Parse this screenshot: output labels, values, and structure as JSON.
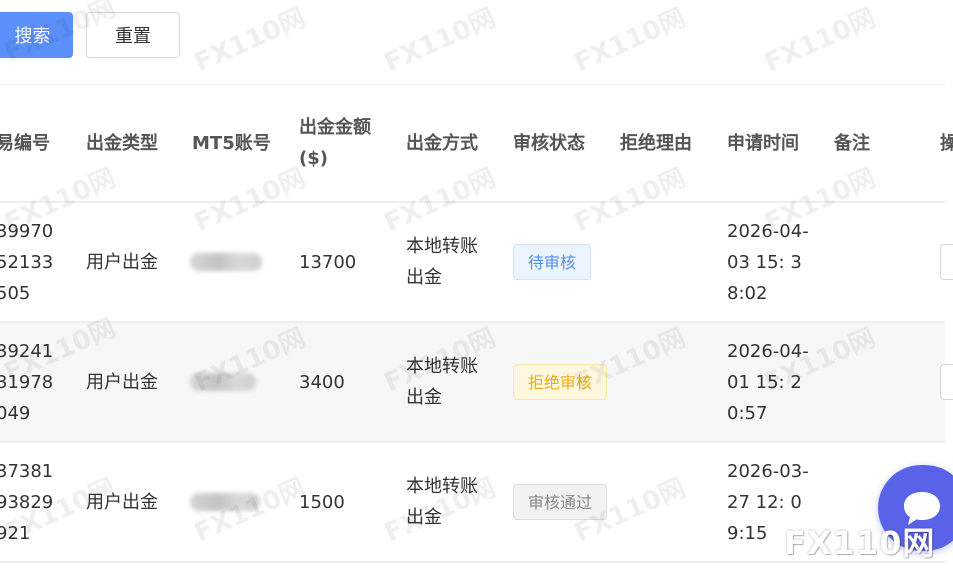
{
  "toolbar": {
    "search_label": "搜索",
    "reset_label": "重置"
  },
  "table": {
    "columns": [
      "易编号",
      "出金类型",
      "MT5账号",
      "出金金额",
      "($)",
      "出金方式",
      "审核状态",
      "拒绝理由",
      "申请时间",
      "备注",
      "操"
    ],
    "rows": [
      {
        "id_lines": [
          "39970",
          "52133",
          "505"
        ],
        "type": "用户出金",
        "amount": "13700",
        "method_lines": [
          "本地转账",
          "出金"
        ],
        "status": "待审核",
        "reason": "",
        "time_lines": [
          "2026-04-",
          "03 15: 3",
          "8:02"
        ],
        "note": ""
      },
      {
        "id_lines": [
          "39241",
          "31978",
          "049"
        ],
        "type": "用户出金",
        "amount": "3400",
        "method_lines": [
          "本地转账",
          "出金"
        ],
        "status": "拒绝审核",
        "reason": "",
        "time_lines": [
          "2026-04-",
          "01 15: 2",
          "0:57"
        ],
        "note": ""
      },
      {
        "id_lines": [
          "37381",
          "93829",
          "921"
        ],
        "type": "用户出金",
        "amount": "1500",
        "method_lines": [
          "本地转账",
          "出金"
        ],
        "status": "审核通过",
        "reason": "",
        "time_lines": [
          "2026-03-",
          "27 12: 0",
          "9:15"
        ],
        "note": ""
      }
    ]
  },
  "watermark": {
    "text": "FX110网",
    "corner_text": "FX110网"
  },
  "colors": {
    "primary": "#5b8ff9",
    "pending": "#4f8ef5",
    "rejected": "#f0ac0d",
    "approved": "#888888",
    "chat": "#5a63e8"
  },
  "icons": {
    "chat": "chat-bubble-icon",
    "mt5_account": "blurred-account-number"
  }
}
